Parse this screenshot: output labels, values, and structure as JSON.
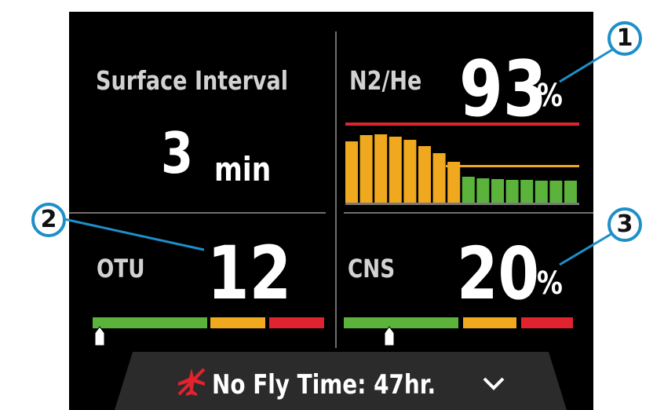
{
  "surface": {
    "label": "Surface Interval",
    "value": "3",
    "unit": "min"
  },
  "n2he": {
    "label": "N2/He",
    "value": "93",
    "unit": "%",
    "tissue_bars_orange": [
      0.78,
      0.86,
      0.87,
      0.84,
      0.8,
      0.72,
      0.63,
      0.52
    ],
    "tissue_bars_green": [
      0.33,
      0.31,
      0.3,
      0.29,
      0.29,
      0.28,
      0.28,
      0.28
    ]
  },
  "otu": {
    "label": "OTU",
    "value": "12",
    "level": 0.03
  },
  "cns": {
    "label": "CNS",
    "value": "20",
    "unit": "%",
    "level": 0.2
  },
  "footer": {
    "text": "No Fly Time: 47hr."
  },
  "callouts": [
    "1",
    "2",
    "3"
  ],
  "colors": {
    "green": "#5cb33c",
    "orange": "#f0a81f",
    "red": "#e0232f",
    "callout": "#1f8fc9"
  },
  "icons": [
    "no-fly-airplane-icon",
    "chevron-down-icon",
    "level-pointer-icon"
  ]
}
